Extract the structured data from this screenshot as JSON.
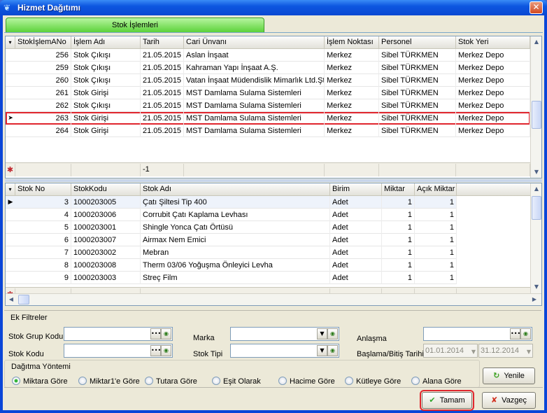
{
  "window": {
    "title": "Hizmet Dağıtımı",
    "close": "✕"
  },
  "tab": {
    "label": "Stok İşlemleri"
  },
  "top_grid": {
    "columns": [
      "StokİşlemANo",
      "İşlem Adı",
      "Tarih",
      "Cari Ünvanı",
      "İşlem Noktası",
      "Personel",
      "Stok Yeri"
    ],
    "rows": [
      [
        "256",
        "Stok Çıkışı",
        "21.05.2015",
        "Aslan İnşaat",
        "Merkez",
        "Sibel TÜRKMEN",
        "Merkez Depo"
      ],
      [
        "259",
        "Stok Çıkışı",
        "21.05.2015",
        "Kahraman Yapı İnşaat A.Ş.",
        "Merkez",
        "Sibel TÜRKMEN",
        "Merkez Depo"
      ],
      [
        "260",
        "Stok Çıkışı",
        "21.05.2015",
        "Vatan İnşaat Müdendislik Mimarlık Ltd.Şti",
        "Merkez",
        "Sibel TÜRKMEN",
        "Merkez Depo"
      ],
      [
        "261",
        "Stok Girişi",
        "21.05.2015",
        "MST Damlama Sulama Sistemleri",
        "Merkez",
        "Sibel TÜRKMEN",
        "Merkez Depo"
      ],
      [
        "262",
        "Stok Çıkışı",
        "21.05.2015",
        "MST Damlama Sulama Sistemleri",
        "Merkez",
        "Sibel TÜRKMEN",
        "Merkez Depo"
      ],
      [
        "263",
        "Stok Girişi",
        "21.05.2015",
        "MST Damlama Sulama Sistemleri",
        "Merkez",
        "Sibel TÜRKMEN",
        "Merkez Depo"
      ],
      [
        "264",
        "Stok Girişi",
        "21.05.2015",
        "MST Damlama Sulama Sistemleri",
        "Merkez",
        "Sibel TÜRKMEN",
        "Merkez Depo"
      ]
    ],
    "selected_index": 5,
    "footer_value": "-1"
  },
  "bottom_grid": {
    "columns": [
      "Stok No",
      "StokKodu",
      "Stok Adı",
      "Birim",
      "Miktar",
      "Açık Miktar"
    ],
    "rows": [
      [
        "3",
        "1000203005",
        "Çatı Şiltesi Tip 400",
        "Adet",
        "1",
        "1"
      ],
      [
        "4",
        "1000203006",
        "Corrubit Çatı Kaplama Levhası",
        "Adet",
        "1",
        "1"
      ],
      [
        "5",
        "1000203001",
        "Shingle Yonca Çatı Örtüsü",
        "Adet",
        "1",
        "1"
      ],
      [
        "6",
        "1000203007",
        "Airmax Nem Emici",
        "Adet",
        "1",
        "1"
      ],
      [
        "7",
        "1000203002",
        "Mebran",
        "Adet",
        "1",
        "1"
      ],
      [
        "8",
        "1000203008",
        "Therm 03/06 Yoğuşma Önleyici Levha",
        "Adet",
        "1",
        "1"
      ],
      [
        "9",
        "1000203003",
        "Streç Film",
        "Adet",
        "1",
        "1"
      ]
    ],
    "selected_index": 0
  },
  "filters": {
    "section_label": "Ek Filtreler",
    "stok_grup_kodu": {
      "label": "Stok Grup Kodu",
      "value": ""
    },
    "stok_kodu": {
      "label": "Stok Kodu",
      "value": ""
    },
    "marka": {
      "label": "Marka",
      "value": ""
    },
    "stok_tipi": {
      "label": "Stok Tipi",
      "value": ""
    },
    "anlasma": {
      "label": "Anlaşma",
      "value": ""
    },
    "tarih": {
      "label": "Başlama/Bitiş Tarihi",
      "start": "01.01.2014",
      "end": "31.12.2014"
    }
  },
  "distribution": {
    "section_label": "Dağıtma Yöntemi",
    "options": [
      "Miktara Göre",
      "Miktar1'e Göre",
      "Tutara Göre",
      "Eşit Olarak",
      "Hacime Göre",
      "Kütleye Göre",
      "Alana Göre"
    ],
    "selected_index": 0
  },
  "buttons": {
    "refresh": "Yenile",
    "ok": "Tamam",
    "cancel": "Vazgeç"
  },
  "colors": {
    "title_bar": "#0a48d2",
    "tab_green": "#5cd23a",
    "highlight_red": "#e0262e",
    "panel": "#ece9d8"
  }
}
